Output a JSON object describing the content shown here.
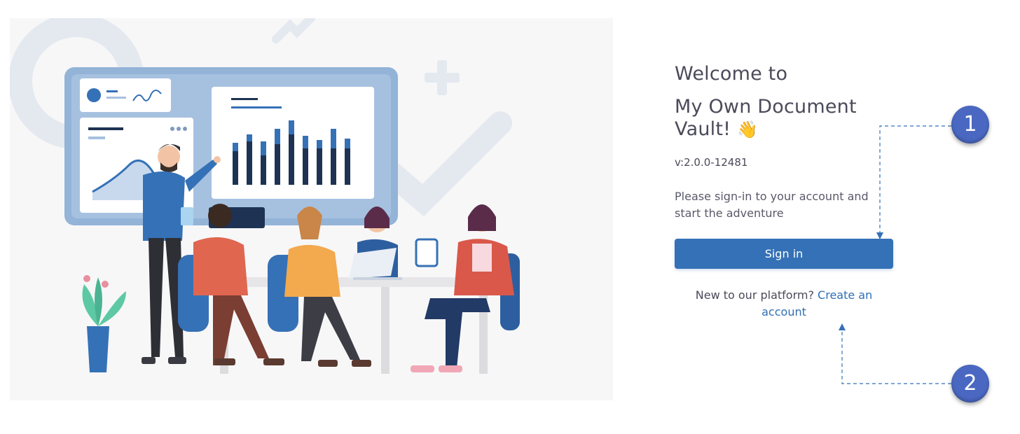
{
  "login": {
    "welcome": "Welcome to",
    "app_name": "My Own Document Vault!",
    "wave_emoji": "👋",
    "version": "v:2.0.0-12481",
    "subtitle": "Please sign-in to your account and start the adventure",
    "signin_label": "Sign in",
    "register_prompt": "New to our platform?",
    "register_link": "Create an account"
  },
  "callouts": {
    "one": "1",
    "two": "2"
  },
  "colors": {
    "primary": "#3571b6",
    "callout": "#4a68c1",
    "text": "#4b4a5a",
    "illustration_bg": "#f7f7f8"
  },
  "icons": {
    "illustration": "team-meeting-illustration",
    "callout_arrow": "dashed-arrow"
  }
}
